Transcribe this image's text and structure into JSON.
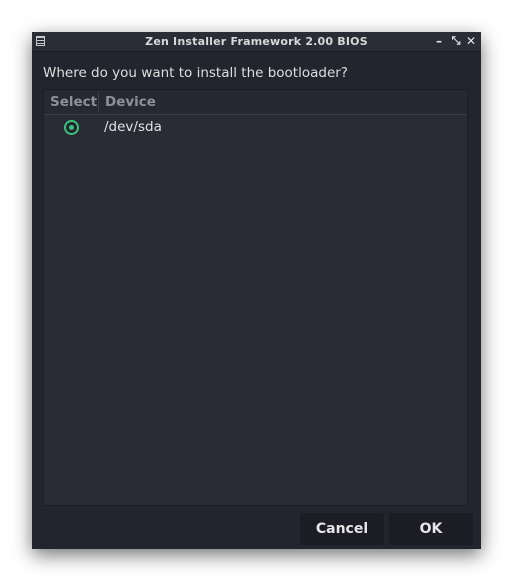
{
  "window": {
    "title": "Zen Installer Framework 2.00 BIOS",
    "controls": {
      "minimize": "–",
      "maximize": "⤡",
      "close": "✕"
    }
  },
  "prompt": "Where do you want to install the bootloader?",
  "table": {
    "columns": [
      "Select",
      "Device"
    ],
    "rows": [
      {
        "selected": true,
        "device": "/dev/sda"
      }
    ]
  },
  "buttons": {
    "cancel": "Cancel",
    "ok": "OK"
  },
  "colors": {
    "accent": "#3cc37c",
    "window_bg": "#23252e",
    "table_bg": "#292b35"
  }
}
